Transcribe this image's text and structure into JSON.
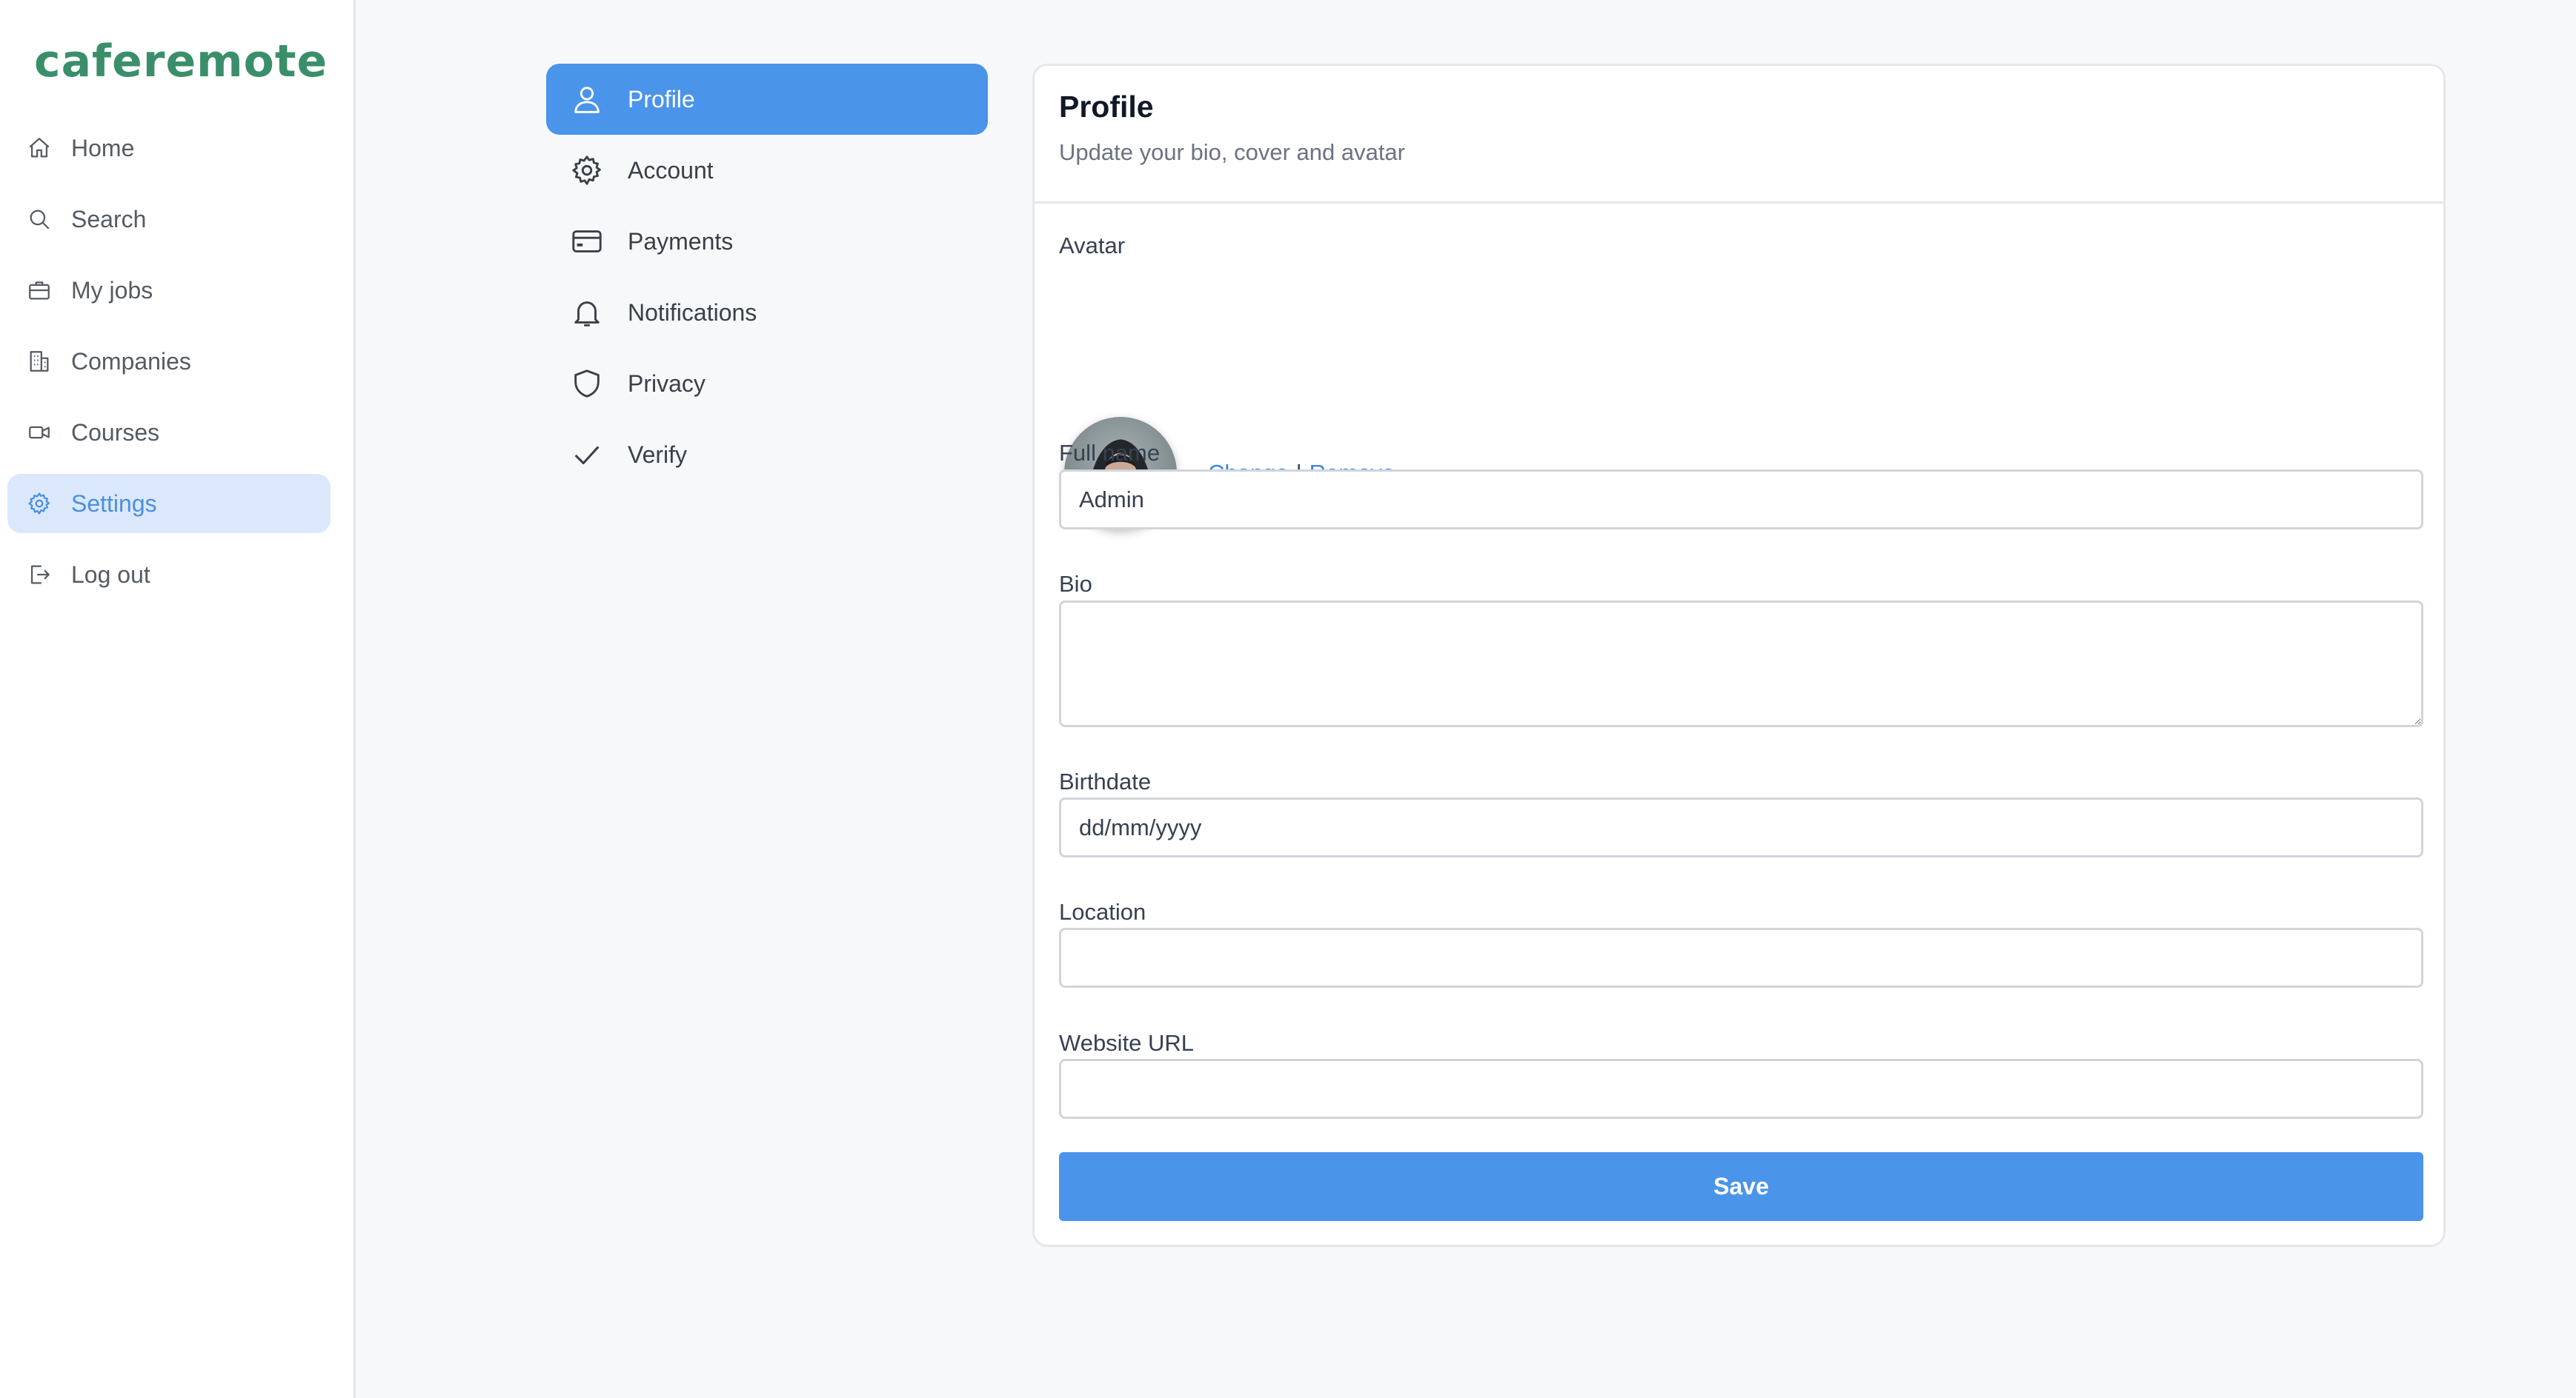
{
  "app": {
    "logo": "caferemote"
  },
  "sidebar": {
    "items": [
      {
        "label": "Home",
        "icon": "home-icon"
      },
      {
        "label": "Search",
        "icon": "search-icon"
      },
      {
        "label": "My jobs",
        "icon": "briefcase-icon"
      },
      {
        "label": "Companies",
        "icon": "building-icon"
      },
      {
        "label": "Courses",
        "icon": "video-icon"
      },
      {
        "label": "Settings",
        "icon": "gear-icon",
        "active": true
      },
      {
        "label": "Log out",
        "icon": "logout-icon"
      }
    ]
  },
  "settings_menu": {
    "items": [
      {
        "label": "Profile",
        "icon": "user-icon",
        "active": true
      },
      {
        "label": "Account",
        "icon": "gear-icon"
      },
      {
        "label": "Payments",
        "icon": "credit-card-icon"
      },
      {
        "label": "Notifications",
        "icon": "bell-icon"
      },
      {
        "label": "Privacy",
        "icon": "shield-icon"
      },
      {
        "label": "Verify",
        "icon": "check-icon"
      }
    ]
  },
  "profile": {
    "title": "Profile",
    "subtitle": "Update your bio, cover and avatar",
    "avatar_label": "Avatar",
    "change_label": "Change",
    "separator": "|",
    "remove_label": "Remove",
    "full_name": {
      "label": "Full name",
      "value": "Admin"
    },
    "bio": {
      "label": "Bio",
      "value": ""
    },
    "birthdate": {
      "label": "Birthdate",
      "placeholder": "dd/mm/yyyy"
    },
    "location": {
      "label": "Location",
      "value": ""
    },
    "website": {
      "label": "Website URL",
      "value": ""
    },
    "save_label": "Save"
  },
  "colors": {
    "brand": "#3a8f6a",
    "accent": "#4a94ea",
    "link": "#3d86d8",
    "active_sidebar_bg": "#dbe8fb"
  }
}
